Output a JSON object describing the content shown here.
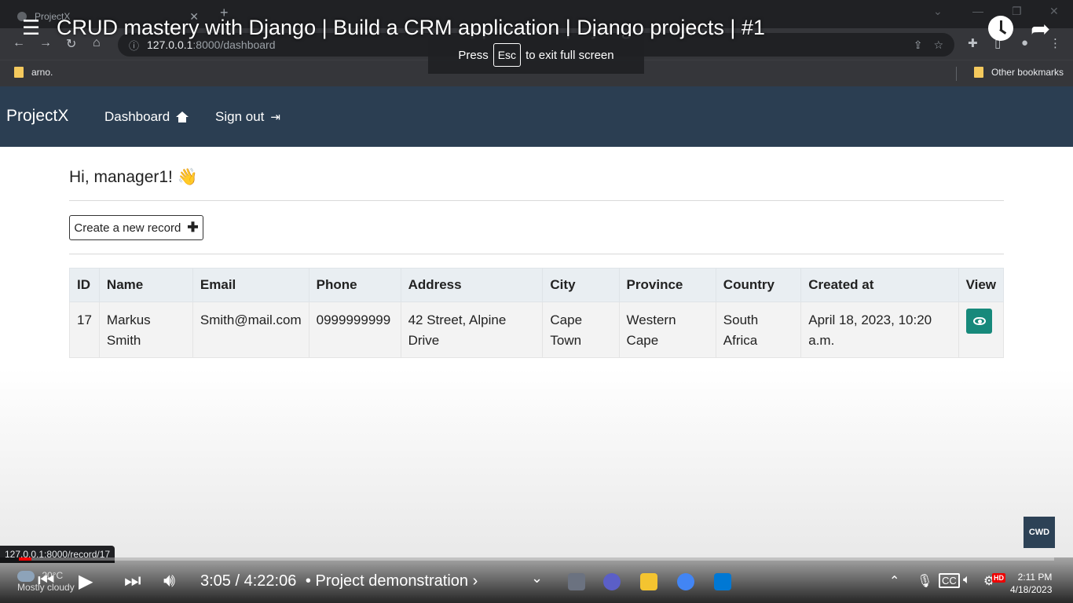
{
  "browser": {
    "tab_title": "ProjectX",
    "tab_close": "✕",
    "new_tab": "+",
    "url_host": "127.0.0.1",
    "url_path": ":8000/dashboard",
    "bookmark_left": "arno.",
    "bookmark_right": "Other bookmarks",
    "status_url": "127.0.0.1:8000/record/17"
  },
  "video": {
    "title": "CRUD mastery with Django | Build a CRM application | Django projects | #1",
    "fullscreen_press": "Press",
    "fullscreen_key": "Esc",
    "fullscreen_suffix": "to exit full screen",
    "time_current": "3:05",
    "time_separator": "/",
    "time_total": "4:22:06",
    "chapter": "• Project demonstration ›",
    "progress": 0.012,
    "channel_badge": "CWD",
    "weather_temp": "20°C",
    "weather_desc": "Mostly cloudy",
    "clock_time": "2:11 PM",
    "clock_date": "4/18/2023",
    "hd_badge": "HD"
  },
  "app": {
    "brand": "ProjectX",
    "nav": {
      "dashboard": "Dashboard",
      "signout": "Sign out"
    },
    "greeting": "Hi, manager1! 👋",
    "create_button": "Create a new record",
    "table": {
      "headers": [
        "ID",
        "Name",
        "Email",
        "Phone",
        "Address",
        "City",
        "Province",
        "Country",
        "Created at",
        "View"
      ],
      "rows": [
        {
          "id": "17",
          "name": "Markus Smith",
          "email": "Smith@mail.com",
          "phone": "0999999999",
          "address": "42 Street, Alpine Drive",
          "city": "Cape Town",
          "province": "Western Cape",
          "country": "South Africa",
          "created_at": "April 18, 2023, 10:20 a.m."
        }
      ]
    }
  },
  "colors": {
    "navbar": "#2b3e52",
    "view_button": "#17897b",
    "table_header": "#e9eef2",
    "progress_played": "#ff0000"
  }
}
